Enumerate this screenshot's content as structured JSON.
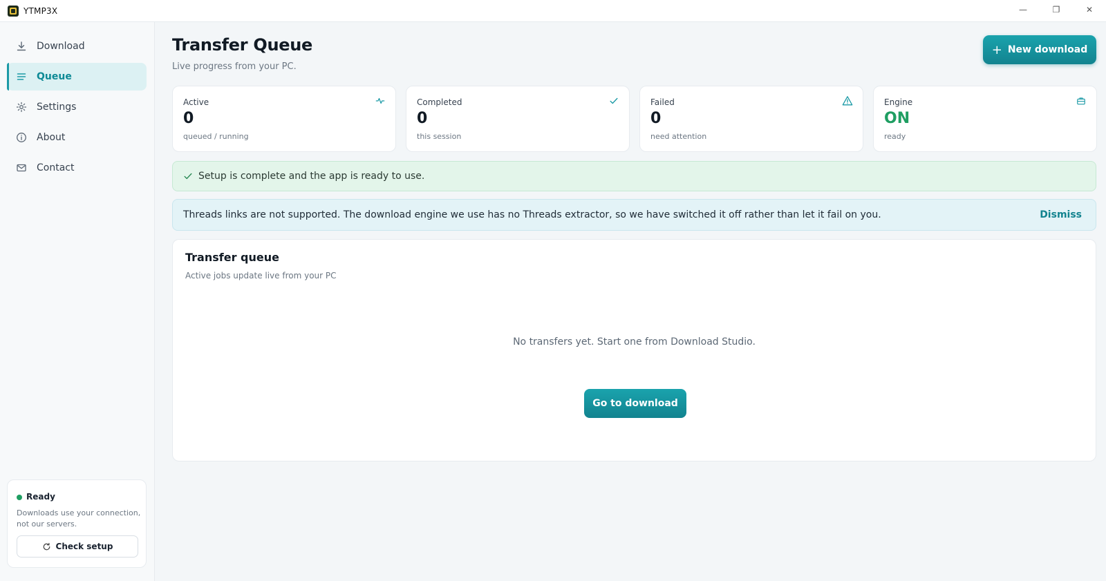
{
  "window": {
    "title": "YTMP3X",
    "minimize_glyph": "—",
    "maximize_glyph": "❐",
    "close_glyph": "✕"
  },
  "sidebar": {
    "items": [
      {
        "label": "Download",
        "icon": "download-icon"
      },
      {
        "label": "Queue",
        "icon": "list-icon",
        "active": true
      },
      {
        "label": "Settings",
        "icon": "gear-icon"
      },
      {
        "label": "About",
        "icon": "info-icon"
      },
      {
        "label": "Contact",
        "icon": "mail-icon"
      }
    ],
    "status": {
      "title": "Ready",
      "description": "Downloads use your connection, not our servers.",
      "button_label": "Check setup"
    }
  },
  "header": {
    "title": "Transfer Queue",
    "subtitle": "Live progress from your PC.",
    "new_button_label": "New download"
  },
  "stats": [
    {
      "label": "Active",
      "value": "0",
      "note": "queued / running",
      "icon": "activity-icon"
    },
    {
      "label": "Completed",
      "value": "0",
      "note": "this session",
      "icon": "check-icon"
    },
    {
      "label": "Failed",
      "value": "0",
      "note": "need attention",
      "icon": "warning-icon"
    },
    {
      "label": "Engine",
      "value": "ON",
      "note": "ready",
      "icon": "briefcase-icon"
    }
  ],
  "banners": {
    "success": "Setup is complete and the app is ready to use.",
    "info": "Threads links are not supported. The download engine we use has no Threads extractor, so we have switched it off rather than let it fail on you.",
    "dismiss_label": "Dismiss"
  },
  "queue": {
    "title": "Transfer queue",
    "subtitle": "Active jobs update live from your PC",
    "empty_message": "No transfers yet. Start one from Download Studio.",
    "go_button_label": "Go to download"
  },
  "colors": {
    "accent": "#1b9aa6",
    "success": "#1f9e62",
    "active_bg": "#dcf1f3"
  }
}
